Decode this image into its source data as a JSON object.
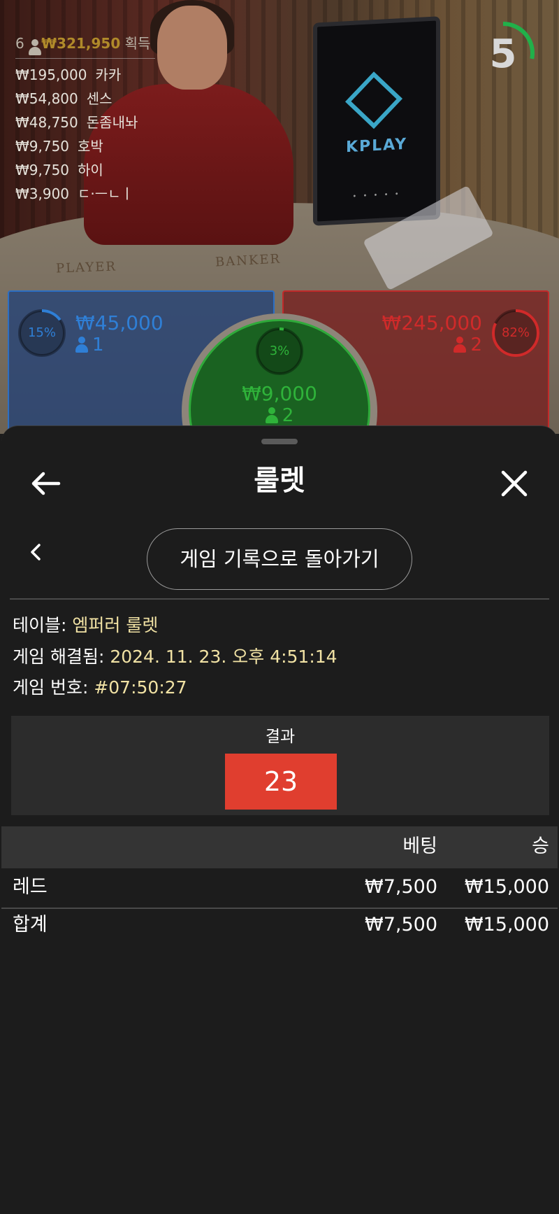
{
  "stream": {
    "winners": {
      "count": "6",
      "total": "₩321,950",
      "suffix": "획득",
      "list": [
        {
          "amount": "₩195,000",
          "name": "카카"
        },
        {
          "amount": "₩54,800",
          "name": "센스"
        },
        {
          "amount": "₩48,750",
          "name": "돈좀내놔"
        },
        {
          "amount": "₩9,750",
          "name": "호박"
        },
        {
          "amount": "₩9,750",
          "name": "하이"
        },
        {
          "amount": "₩3,900",
          "name": "ㄷ·ㅡㄴㅣ"
        }
      ]
    },
    "countdown": "5",
    "countdown_fraction": 0.28,
    "monitor_brand": "KPLAY",
    "table_labels": {
      "player": "PLAYER",
      "banker": "BANKER"
    },
    "bets": {
      "player": {
        "percent": "15%",
        "percent_value": 0.15,
        "amount": "₩45,000",
        "players": "1",
        "color": "#2f7fd6"
      },
      "tie": {
        "percent": "3%",
        "percent_value": 0.03,
        "amount": "₩9,000",
        "players": "2",
        "color": "#2fb33a"
      },
      "banker": {
        "percent": "82%",
        "percent_value": 0.82,
        "amount": "₩245,000",
        "players": "2",
        "color": "#d02a2a"
      }
    }
  },
  "sheet": {
    "title": "룰렛",
    "back_to_history": "게임 기록으로 돌아가기",
    "info": {
      "table_label": "테이블:",
      "table_value": "엠퍼러 룰렛",
      "resolved_label": "게임 해결됨:",
      "resolved_value": "2024. 11. 23. 오후 4:51:14",
      "game_no_label": "게임 번호:",
      "game_no_value": "#07:50:27"
    },
    "result": {
      "label": "결과",
      "number": "23",
      "color": "#e03e2f"
    },
    "table": {
      "headers": {
        "bet": "베팅",
        "win": "승"
      },
      "rows": [
        {
          "name": "레드",
          "bet": "₩7,500",
          "win": "₩15,000"
        }
      ],
      "total": {
        "name": "합계",
        "bet": "₩7,500",
        "win": "₩15,000"
      }
    }
  }
}
